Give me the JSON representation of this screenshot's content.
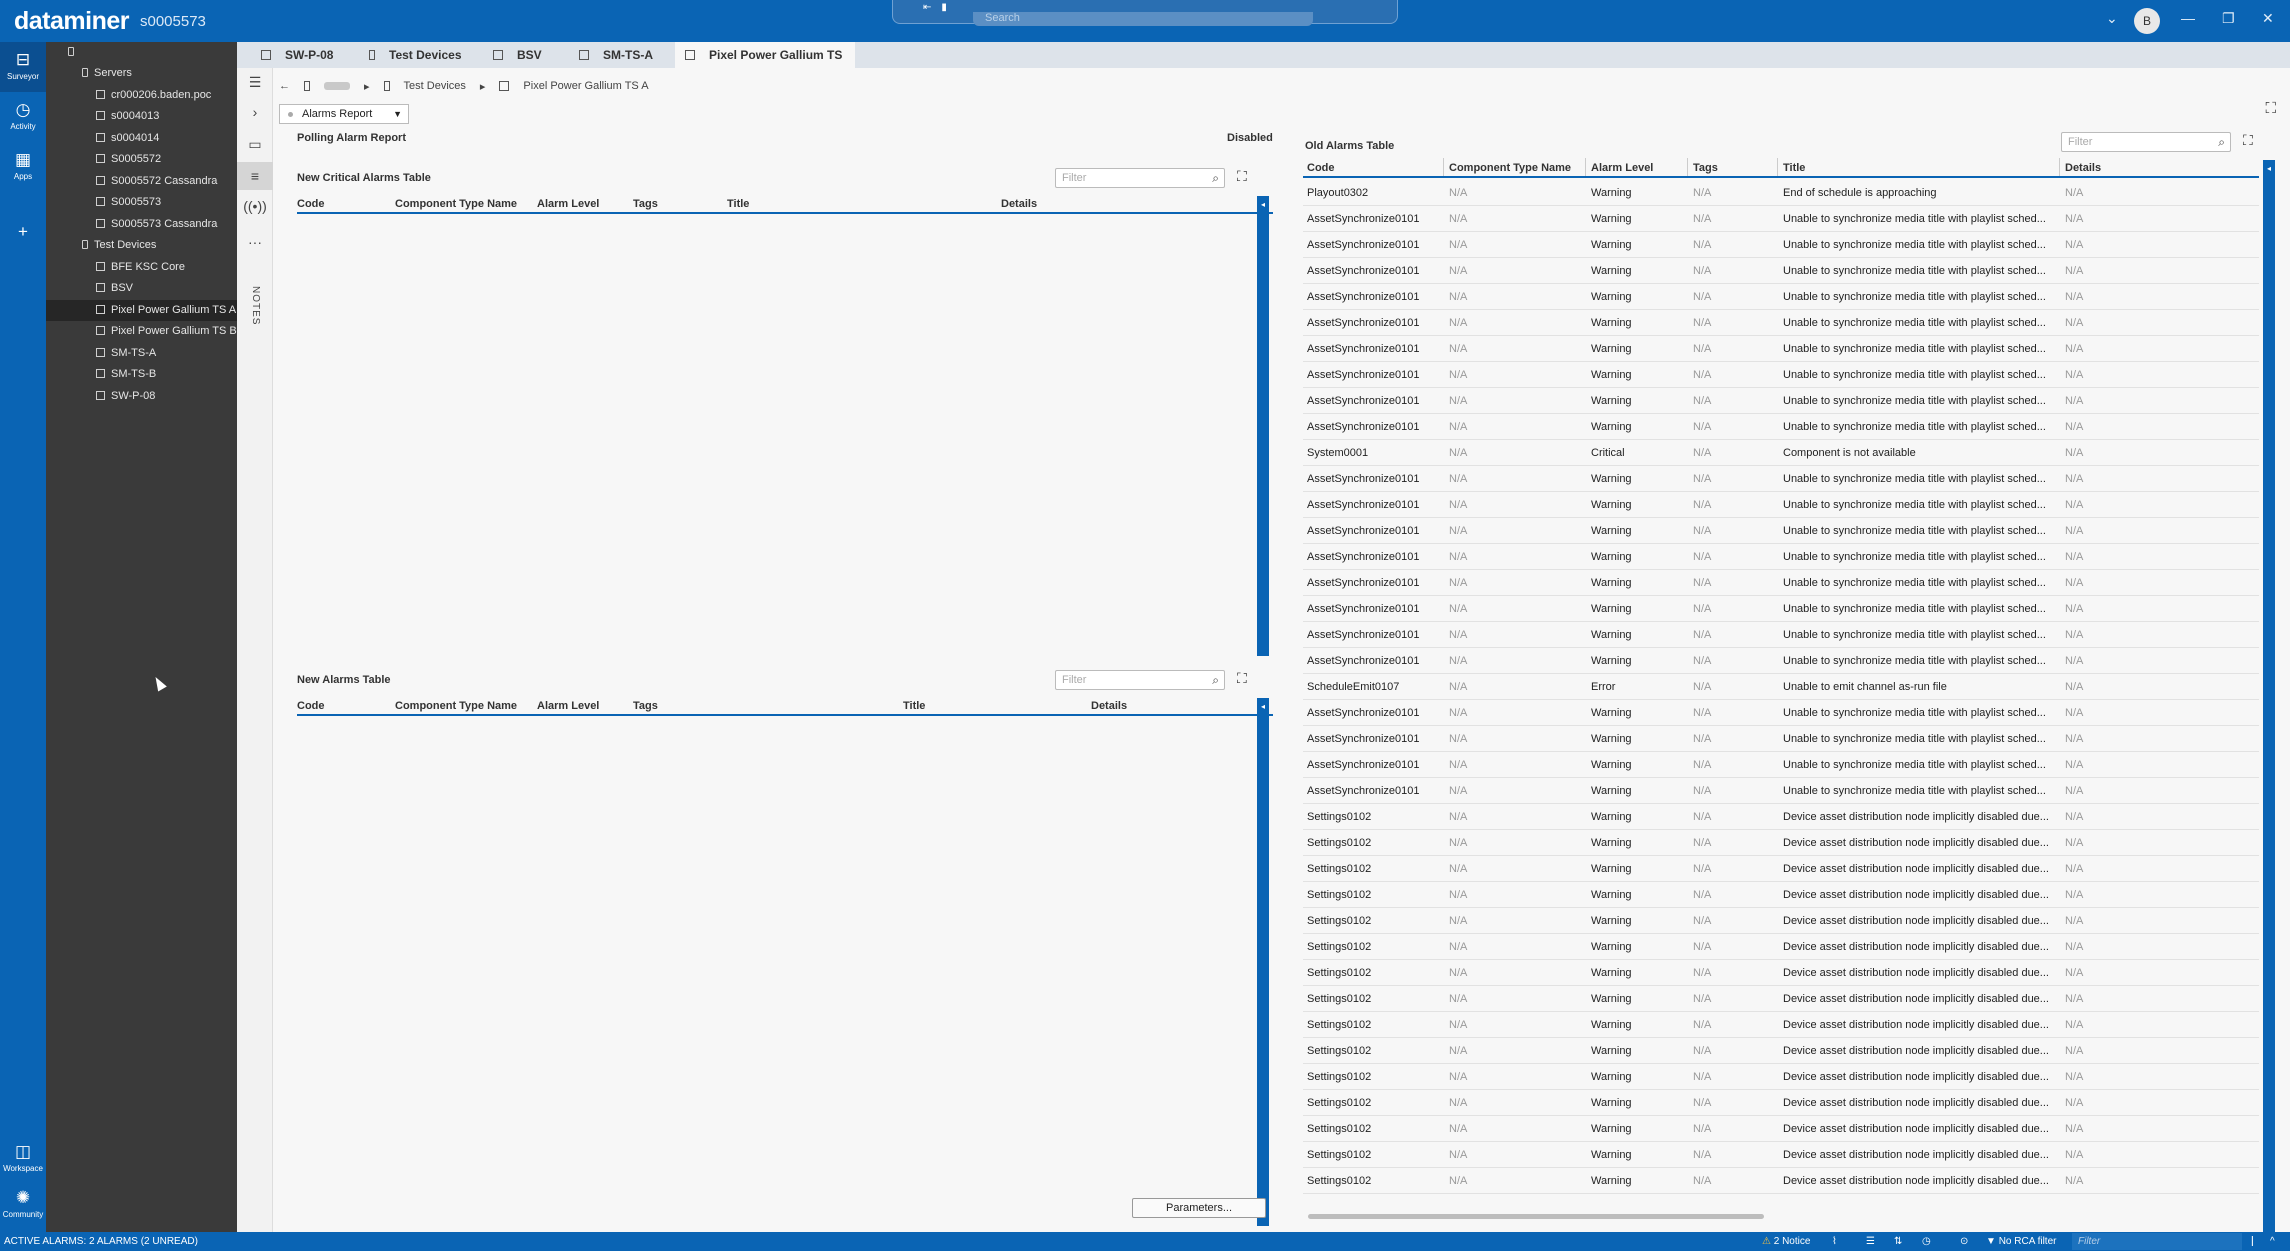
{
  "app": {
    "brand": "dataminer",
    "agent": "s0005573",
    "search_placeholder": "Search",
    "user_initial": "B"
  },
  "leftnav": [
    {
      "label": "Surveyor",
      "icon": "surveyor-icon"
    },
    {
      "label": "Activity",
      "icon": "activity-icon"
    },
    {
      "label": "Apps",
      "icon": "apps-icon"
    },
    {
      "label": "Workspace",
      "icon": "workspace-icon"
    },
    {
      "label": "Community",
      "icon": "community-icon"
    }
  ],
  "surveyor": {
    "root": "",
    "servers_label": "Servers",
    "servers": [
      "cr000206.baden.poc",
      "s0004013",
      "s0004014",
      "S0005572",
      "S0005572 Cassandra",
      "S0005573",
      "S0005573 Cassandra"
    ],
    "test_devices_label": "Test Devices",
    "test_devices": [
      "BFE KSC Core",
      "BSV",
      "Pixel Power Gallium TS A",
      "Pixel Power Gallium TS B",
      "SM-TS-A",
      "SM-TS-B",
      "SW-P-08"
    ],
    "selected": "Pixel Power Gallium TS A"
  },
  "tabs": [
    {
      "label": "SW-P-08",
      "active": false
    },
    {
      "label": "Test Devices",
      "active": false
    },
    {
      "label": "BSV",
      "active": false
    },
    {
      "label": "SM-TS-A",
      "active": false
    },
    {
      "label": "Pixel Power Gallium TS A",
      "active": true
    }
  ],
  "breadcrumb": {
    "root": "",
    "view": "Test Devices",
    "element": "Pixel Power Gallium TS A"
  },
  "page_select": "Alarms Report",
  "left_panel": {
    "polling_title": "Polling Alarm Report",
    "polling_status": "Disabled",
    "critical_table": {
      "title": "New Critical Alarms Table",
      "filter_placeholder": "Filter",
      "columns": [
        "Code",
        "Component Type Name",
        "Alarm Level",
        "Tags",
        "Title",
        "Details"
      ]
    },
    "new_table": {
      "title": "New Alarms Table",
      "filter_placeholder": "Filter",
      "columns": [
        "Code",
        "Component Type Name",
        "Alarm Level",
        "Tags",
        "Title",
        "Details"
      ]
    },
    "parameters_button": "Parameters..."
  },
  "old_alarms": {
    "title": "Old Alarms Table",
    "filter_placeholder": "Filter",
    "columns": [
      "Code",
      "Component Type Name",
      "Alarm Level",
      "Tags",
      "Title",
      "Details"
    ],
    "rows": [
      [
        "Playout0302",
        "N/A",
        "Warning",
        "N/A",
        "End of schedule is approaching",
        "N/A"
      ],
      [
        "AssetSynchronize0101",
        "N/A",
        "Warning",
        "N/A",
        "Unable to synchronize media title with playlist sched...",
        "N/A"
      ],
      [
        "AssetSynchronize0101",
        "N/A",
        "Warning",
        "N/A",
        "Unable to synchronize media title with playlist sched...",
        "N/A"
      ],
      [
        "AssetSynchronize0101",
        "N/A",
        "Warning",
        "N/A",
        "Unable to synchronize media title with playlist sched...",
        "N/A"
      ],
      [
        "AssetSynchronize0101",
        "N/A",
        "Warning",
        "N/A",
        "Unable to synchronize media title with playlist sched...",
        "N/A"
      ],
      [
        "AssetSynchronize0101",
        "N/A",
        "Warning",
        "N/A",
        "Unable to synchronize media title with playlist sched...",
        "N/A"
      ],
      [
        "AssetSynchronize0101",
        "N/A",
        "Warning",
        "N/A",
        "Unable to synchronize media title with playlist sched...",
        "N/A"
      ],
      [
        "AssetSynchronize0101",
        "N/A",
        "Warning",
        "N/A",
        "Unable to synchronize media title with playlist sched...",
        "N/A"
      ],
      [
        "AssetSynchronize0101",
        "N/A",
        "Warning",
        "N/A",
        "Unable to synchronize media title with playlist sched...",
        "N/A"
      ],
      [
        "AssetSynchronize0101",
        "N/A",
        "Warning",
        "N/A",
        "Unable to synchronize media title with playlist sched...",
        "N/A"
      ],
      [
        "System0001",
        "N/A",
        "Critical",
        "N/A",
        "Component is not available",
        "N/A"
      ],
      [
        "AssetSynchronize0101",
        "N/A",
        "Warning",
        "N/A",
        "Unable to synchronize media title with playlist sched...",
        "N/A"
      ],
      [
        "AssetSynchronize0101",
        "N/A",
        "Warning",
        "N/A",
        "Unable to synchronize media title with playlist sched...",
        "N/A"
      ],
      [
        "AssetSynchronize0101",
        "N/A",
        "Warning",
        "N/A",
        "Unable to synchronize media title with playlist sched...",
        "N/A"
      ],
      [
        "AssetSynchronize0101",
        "N/A",
        "Warning",
        "N/A",
        "Unable to synchronize media title with playlist sched...",
        "N/A"
      ],
      [
        "AssetSynchronize0101",
        "N/A",
        "Warning",
        "N/A",
        "Unable to synchronize media title with playlist sched...",
        "N/A"
      ],
      [
        "AssetSynchronize0101",
        "N/A",
        "Warning",
        "N/A",
        "Unable to synchronize media title with playlist sched...",
        "N/A"
      ],
      [
        "AssetSynchronize0101",
        "N/A",
        "Warning",
        "N/A",
        "Unable to synchronize media title with playlist sched...",
        "N/A"
      ],
      [
        "AssetSynchronize0101",
        "N/A",
        "Warning",
        "N/A",
        "Unable to synchronize media title with playlist sched...",
        "N/A"
      ],
      [
        "ScheduleEmit0107",
        "N/A",
        "Error",
        "N/A",
        "Unable to emit channel as-run file",
        "N/A"
      ],
      [
        "AssetSynchronize0101",
        "N/A",
        "Warning",
        "N/A",
        "Unable to synchronize media title with playlist sched...",
        "N/A"
      ],
      [
        "AssetSynchronize0101",
        "N/A",
        "Warning",
        "N/A",
        "Unable to synchronize media title with playlist sched...",
        "N/A"
      ],
      [
        "AssetSynchronize0101",
        "N/A",
        "Warning",
        "N/A",
        "Unable to synchronize media title with playlist sched...",
        "N/A"
      ],
      [
        "AssetSynchronize0101",
        "N/A",
        "Warning",
        "N/A",
        "Unable to synchronize media title with playlist sched...",
        "N/A"
      ],
      [
        "Settings0102",
        "N/A",
        "Warning",
        "N/A",
        "Device asset distribution node implicitly disabled due...",
        "N/A"
      ],
      [
        "Settings0102",
        "N/A",
        "Warning",
        "N/A",
        "Device asset distribution node implicitly disabled due...",
        "N/A"
      ],
      [
        "Settings0102",
        "N/A",
        "Warning",
        "N/A",
        "Device asset distribution node implicitly disabled due...",
        "N/A"
      ],
      [
        "Settings0102",
        "N/A",
        "Warning",
        "N/A",
        "Device asset distribution node implicitly disabled due...",
        "N/A"
      ],
      [
        "Settings0102",
        "N/A",
        "Warning",
        "N/A",
        "Device asset distribution node implicitly disabled due...",
        "N/A"
      ],
      [
        "Settings0102",
        "N/A",
        "Warning",
        "N/A",
        "Device asset distribution node implicitly disabled due...",
        "N/A"
      ],
      [
        "Settings0102",
        "N/A",
        "Warning",
        "N/A",
        "Device asset distribution node implicitly disabled due...",
        "N/A"
      ],
      [
        "Settings0102",
        "N/A",
        "Warning",
        "N/A",
        "Device asset distribution node implicitly disabled due...",
        "N/A"
      ],
      [
        "Settings0102",
        "N/A",
        "Warning",
        "N/A",
        "Device asset distribution node implicitly disabled due...",
        "N/A"
      ],
      [
        "Settings0102",
        "N/A",
        "Warning",
        "N/A",
        "Device asset distribution node implicitly disabled due...",
        "N/A"
      ],
      [
        "Settings0102",
        "N/A",
        "Warning",
        "N/A",
        "Device asset distribution node implicitly disabled due...",
        "N/A"
      ],
      [
        "Settings0102",
        "N/A",
        "Warning",
        "N/A",
        "Device asset distribution node implicitly disabled due...",
        "N/A"
      ],
      [
        "Settings0102",
        "N/A",
        "Warning",
        "N/A",
        "Device asset distribution node implicitly disabled due...",
        "N/A"
      ],
      [
        "Settings0102",
        "N/A",
        "Warning",
        "N/A",
        "Device asset distribution node implicitly disabled due...",
        "N/A"
      ],
      [
        "Settings0102",
        "N/A",
        "Warning",
        "N/A",
        "Device asset distribution node implicitly disabled due...",
        "N/A"
      ]
    ]
  },
  "status_bar": {
    "active_alarms": "ACTIVE ALARMS: 2 ALARMS (2 UNREAD)",
    "notice": "2 Notice",
    "rca": "No RCA filter",
    "filter_placeholder": "Filter"
  },
  "colors": {
    "brand_blue": "#0a64b4",
    "tree_bg": "#3a3a3a"
  }
}
